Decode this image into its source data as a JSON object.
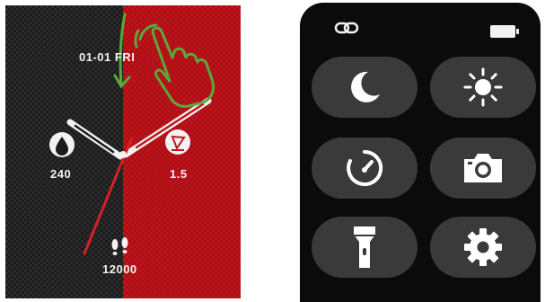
{
  "watch_face": {
    "date": "01-01 FRI",
    "water_value": "240",
    "distance_value": "1.5",
    "steps_value": "12000",
    "icons": [
      "water-drop-icon",
      "distance-icon",
      "footsteps-icon",
      "tap-hand-icon",
      "down-arrow-icon"
    ],
    "colors": {
      "left_half": "#1b1b1b",
      "right_half": "#c0141c",
      "gesture_green": "#5aa83a",
      "second_hand": "#d42028"
    }
  },
  "control_center": {
    "status_icons": [
      "link-icon",
      "battery-icon"
    ],
    "tiles": [
      {
        "icon": "moon-icon"
      },
      {
        "icon": "brightness-sun-icon"
      },
      {
        "icon": "timer-icon"
      },
      {
        "icon": "camera-icon"
      },
      {
        "icon": "flashlight-icon"
      },
      {
        "icon": "settings-gear-icon"
      }
    ],
    "colors": {
      "background": "#0b0b0b",
      "tile": "#3a3a3a",
      "icon": "#ffffff"
    }
  }
}
